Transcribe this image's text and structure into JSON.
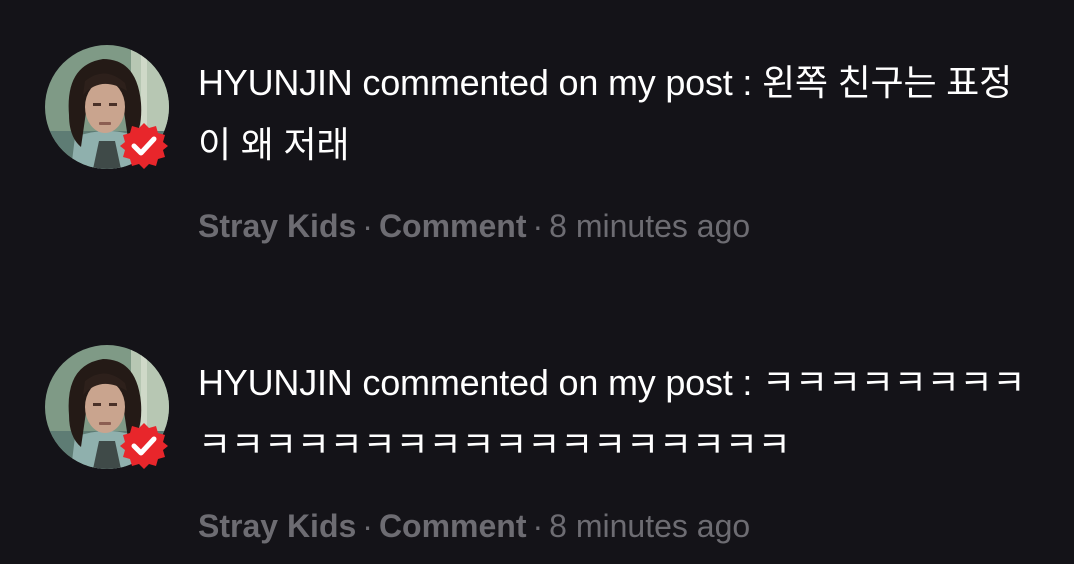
{
  "colors": {
    "background": "#141318",
    "primary_text": "#ffffff",
    "secondary_text": "#6d6c72",
    "verified_badge": "#e8262b"
  },
  "notifications": [
    {
      "avatar_icon": "user-avatar",
      "badge_icon": "verified-check-icon",
      "message": "HYUNJIN commented on my post : 왼쪽 친구는 표정이 왜 저래",
      "group": "Stray Kids",
      "separator_1": "·",
      "type": "Comment",
      "separator_2": "·",
      "time": "8 minutes ago"
    },
    {
      "avatar_icon": "user-avatar",
      "badge_icon": "verified-check-icon",
      "message": "HYUNJIN commented on my post : ㅋㅋㅋㅋㅋㅋㅋㅋㅋㅋㅋㅋㅋㅋㅋㅋㅋㅋㅋㅋㅋㅋㅋㅋㅋㅋ",
      "group": "Stray Kids",
      "separator_1": "·",
      "type": "Comment",
      "separator_2": "·",
      "time": "8 minutes ago"
    }
  ]
}
